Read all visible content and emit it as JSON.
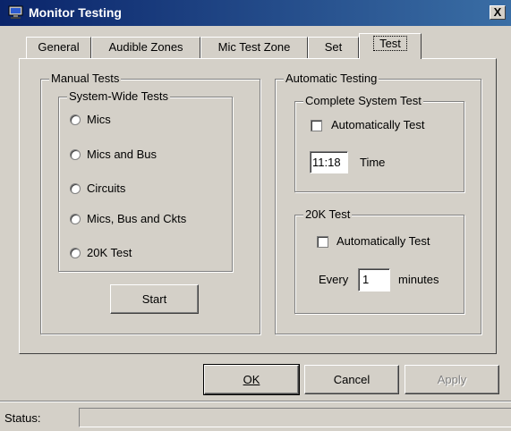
{
  "window": {
    "title": "Monitor Testing",
    "close_label": "X"
  },
  "tabs": [
    {
      "label": "General"
    },
    {
      "label": "Audible Zones"
    },
    {
      "label": "Mic Test Zone"
    },
    {
      "label": "Set"
    },
    {
      "label": "Test",
      "active": true
    }
  ],
  "manual": {
    "legend": "Manual Tests",
    "system_wide_legend": "System-Wide Tests",
    "options": [
      "Mics",
      "Mics and Bus",
      "Circuits",
      "Mics, Bus and Ckts",
      "20K Test"
    ],
    "start_label": "Start"
  },
  "automatic": {
    "legend": "Automatic Testing",
    "complete": {
      "legend": "Complete System Test",
      "auto_label": "Automatically Test",
      "auto_checked": false,
      "time_value": "11:18",
      "time_label": "Time"
    },
    "k20": {
      "legend": "20K Test",
      "auto_label": "Automatically Test",
      "auto_checked": false,
      "every_label": "Every",
      "every_value": "1",
      "minutes_label": "minutes"
    }
  },
  "buttons": {
    "ok": "OK",
    "cancel": "Cancel",
    "apply": "Apply"
  },
  "status": {
    "label": "Status:",
    "value": ""
  }
}
